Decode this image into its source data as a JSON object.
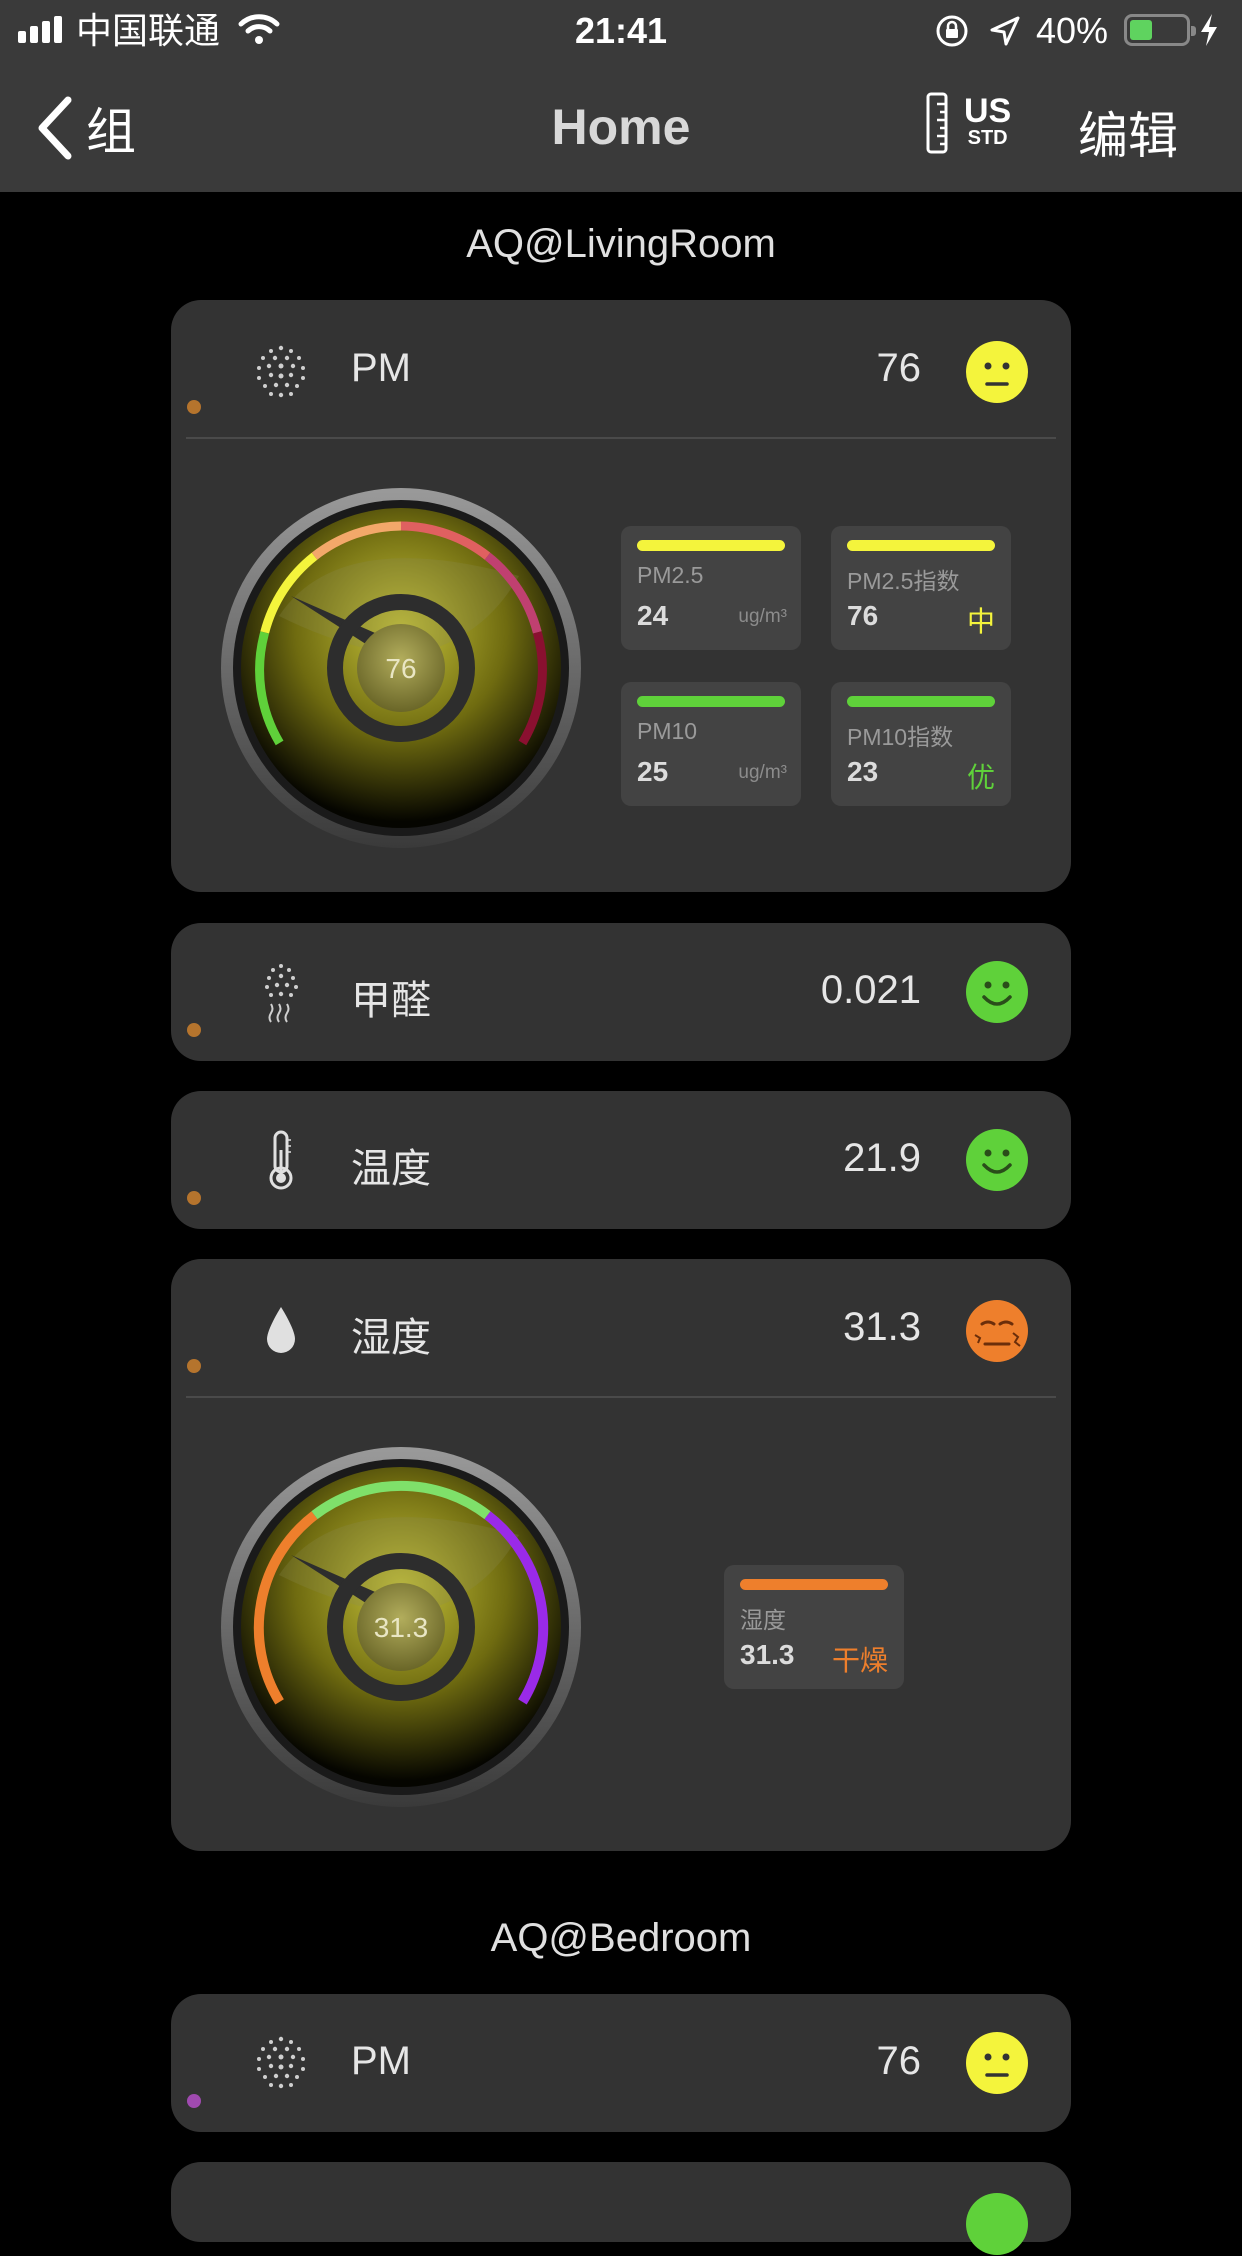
{
  "status_bar": {
    "carrier": "中国联通",
    "time": "21:41",
    "battery_percent": "40%",
    "battery_level": 0.4
  },
  "nav": {
    "back_label": "组",
    "title": "Home",
    "units_top": "US",
    "units_bottom": "STD",
    "edit_label": "编辑"
  },
  "colors": {
    "yellow": "#f4f43c",
    "green": "#5fd13a",
    "orange": "#ee7f2c",
    "dot_orange": "#b5742d",
    "dot_purple": "#a04ab0"
  },
  "groups": [
    {
      "name": "AQ@LivingRoom",
      "pm": {
        "label": "PM",
        "value": "76",
        "face": "neutral",
        "gauge_value": "76",
        "tiles": [
          {
            "label": "PM2.5",
            "value": "24",
            "unit": "ug/m³"
          },
          {
            "label": "PM2.5指数",
            "value": "76",
            "level": "中"
          },
          {
            "label": "PM10",
            "value": "25",
            "unit": "ug/m³"
          },
          {
            "label": "PM10指数",
            "value": "23",
            "level": "优"
          }
        ]
      },
      "formaldehyde": {
        "label": "甲醛",
        "value": "0.021",
        "face": "happy"
      },
      "temperature": {
        "label": "温度",
        "value": "21.9",
        "face": "happy"
      },
      "humidity": {
        "label": "湿度",
        "value": "31.3",
        "face": "dry",
        "gauge_value": "31.3",
        "tile": {
          "label": "湿度",
          "value": "31.3",
          "level": "干燥"
        }
      }
    },
    {
      "name": "AQ@Bedroom",
      "pm": {
        "label": "PM",
        "value": "76",
        "face": "neutral"
      }
    }
  ]
}
